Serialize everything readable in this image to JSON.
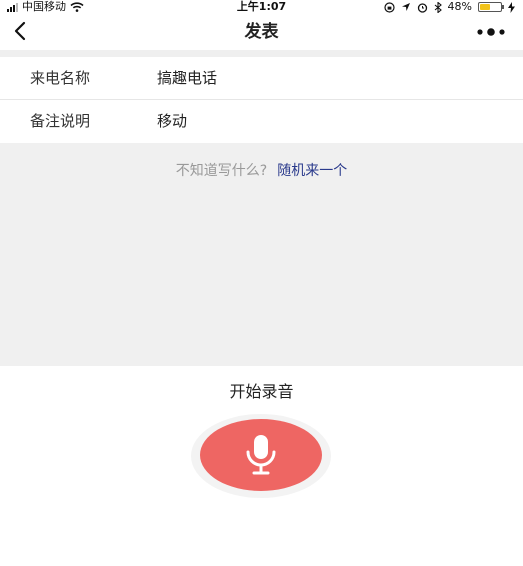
{
  "status_bar": {
    "carrier": "中国移动",
    "time": "上午1:07",
    "battery": "48%",
    "battery_level": 0.48
  },
  "nav": {
    "title": "发表",
    "back_icon": "chevron-left-icon",
    "more_icon": "more-dots-icon"
  },
  "form": {
    "rows": [
      {
        "label": "来电名称",
        "value": "搞趣电话"
      },
      {
        "label": "备注说明",
        "value": "移动"
      }
    ]
  },
  "hint": {
    "question": "不知道写什么?",
    "random_link": "随机来一个"
  },
  "recording": {
    "label": "开始录音",
    "button_icon": "microphone-icon",
    "button_color": "#ee6663"
  }
}
